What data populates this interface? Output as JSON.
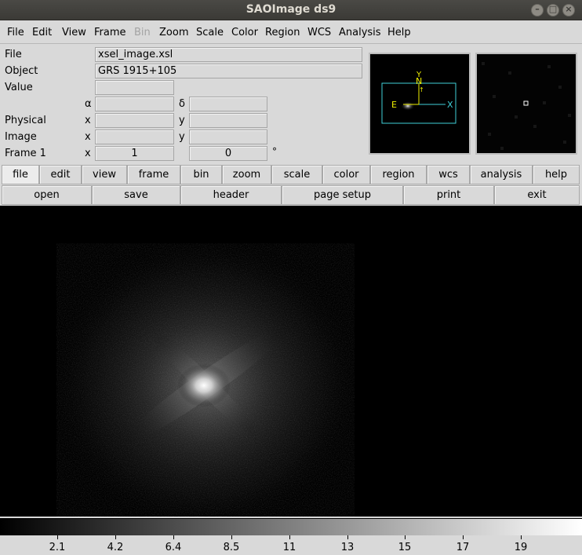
{
  "window": {
    "title": "SAOImage ds9"
  },
  "menubar": {
    "items": [
      "File",
      "Edit",
      "View",
      "Frame",
      "Bin",
      "Zoom",
      "Scale",
      "Color",
      "Region",
      "WCS",
      "Analysis",
      "Help"
    ]
  },
  "info": {
    "file_label": "File",
    "file_value": "xsel_image.xsl",
    "object_label": "Object",
    "object_value": "GRS 1915+105",
    "value_label": "Value",
    "wcs_alpha": "α",
    "wcs_delta": "δ",
    "physical_label": "Physical",
    "image_label": "Image",
    "frame_label": "Frame 1",
    "x_label": "x",
    "y_label": "y",
    "frame_zoom": "1",
    "frame_angle": "0",
    "degree_sign": "°"
  },
  "panner": {
    "compass_n": "N",
    "compass_e": "E",
    "axis_y": "Y",
    "axis_x": "X"
  },
  "buttonbar": {
    "row1": [
      "file",
      "edit",
      "view",
      "frame",
      "bin",
      "zoom",
      "scale",
      "color",
      "region",
      "wcs",
      "analysis",
      "help"
    ],
    "row2": [
      "open",
      "save",
      "header",
      "page setup",
      "print",
      "exit"
    ]
  },
  "colorbar": {
    "tick_labels": [
      "2.1",
      "4.2",
      "6.4",
      "8.5",
      "11",
      "13",
      "15",
      "17",
      "19"
    ]
  },
  "colors": {
    "panner_box": "#3fd0d8",
    "compass": "#f0f000"
  }
}
